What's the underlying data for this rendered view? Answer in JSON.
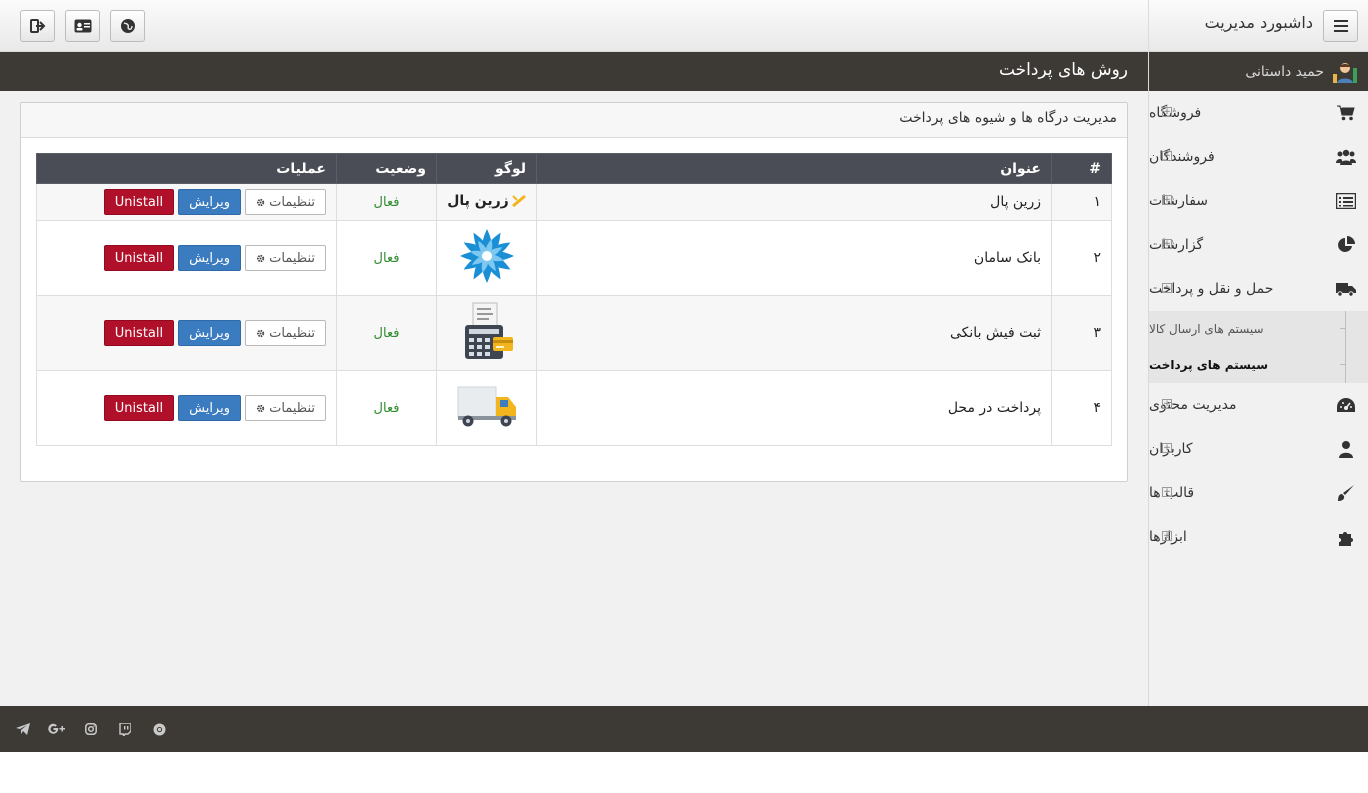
{
  "header": {
    "brand_title": "داشبورد مدیریت"
  },
  "page": {
    "title": "روش های پرداخت"
  },
  "sidebar": {
    "user_name": "حمید داستانی",
    "items": [
      {
        "label": "فروشگاه",
        "icon": "cart-icon"
      },
      {
        "label": "فروشندگان",
        "icon": "users-icon"
      },
      {
        "label": "سفارشات",
        "icon": "list-icon"
      },
      {
        "label": "گزارشات",
        "icon": "pie-chart-icon"
      },
      {
        "label": "حمل و نقل و پرداخت",
        "icon": "truck-icon"
      },
      {
        "label": "مدیریت محتوی",
        "icon": "dashboard-icon"
      },
      {
        "label": "کاربران",
        "icon": "user-icon"
      },
      {
        "label": "قالب ها",
        "icon": "paint-brush-icon"
      },
      {
        "label": "ابزارها",
        "icon": "puzzle-icon"
      }
    ],
    "submenu": [
      {
        "label": "سیستم های ارسال کالا"
      },
      {
        "label": "سیستم های پرداخت"
      }
    ]
  },
  "panel": {
    "heading": "مدیریت درگاه ها و شیوه های پرداخت"
  },
  "table": {
    "headers": [
      "#",
      "عنوان",
      "لوگو",
      "وضعیت",
      "عملیات"
    ],
    "rows": [
      {
        "num": "۱",
        "title": "زرین پال",
        "logo": "zarinpal-logo",
        "logo_text": "زرین پال",
        "status": "فعال"
      },
      {
        "num": "۲",
        "title": "بانک سامان",
        "logo": "saman-bank-logo",
        "status": "فعال"
      },
      {
        "num": "۳",
        "title": "ثبت فیش بانکی",
        "logo": "bank-receipt-logo",
        "status": "فعال"
      },
      {
        "num": "۴",
        "title": "پرداخت در محل",
        "logo": "delivery-truck-logo",
        "status": "فعال"
      }
    ],
    "actions": {
      "settings": "تنظیمات",
      "edit": "ویرایش",
      "uninstall": "Unistall"
    }
  },
  "colors": {
    "dark_bar": "#3d3a36",
    "table_header": "#4a4d55",
    "primary": "#3b7bbf",
    "danger": "#b0102a",
    "status_active": "#2e8b2e"
  }
}
